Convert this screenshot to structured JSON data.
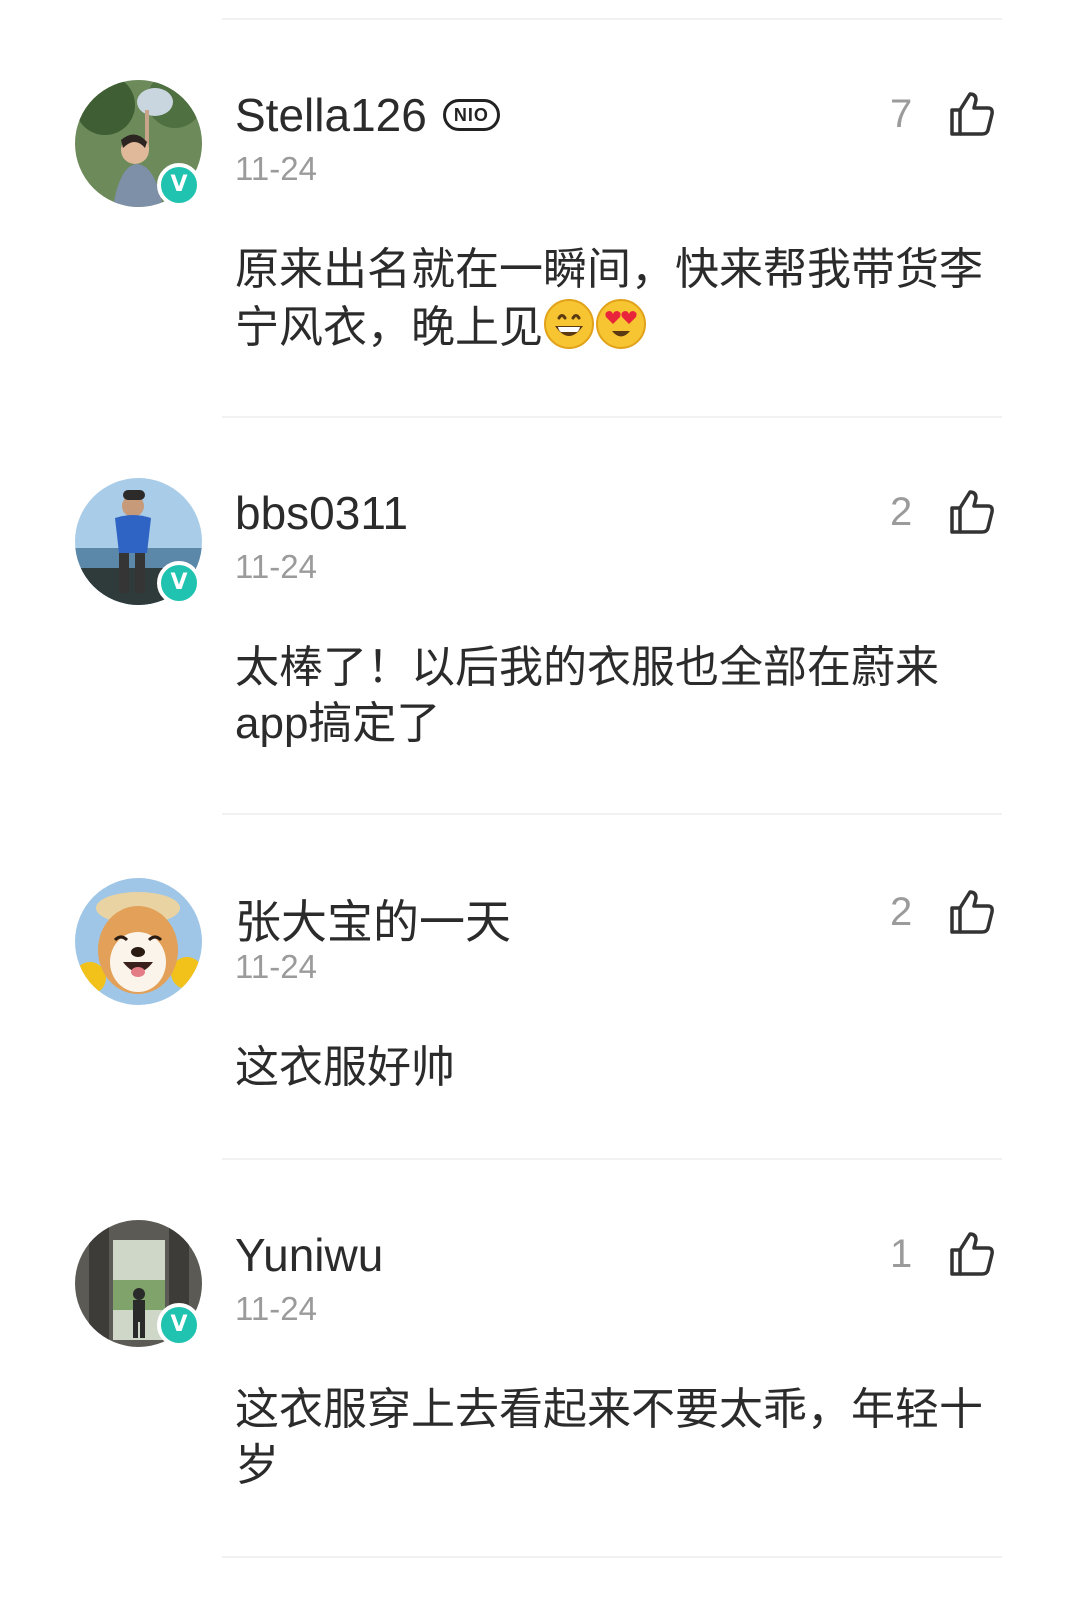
{
  "comments": [
    {
      "username": "Stella126",
      "badge": "NIO",
      "date": "11-24",
      "likes": "7",
      "text": "原来出名就在一瞬间，快来帮我带货李宁风衣，晚上见",
      "verified": "V"
    },
    {
      "username": "bbs0311",
      "date": "11-24",
      "likes": "2",
      "text": "太棒了！以后我的衣服也全部在蔚来app搞定了",
      "verified": "V"
    },
    {
      "username": "张大宝的一天",
      "date": "11-24",
      "likes": "2",
      "text": "这衣服好帅"
    },
    {
      "username": "Yuniwu",
      "date": "11-24",
      "likes": "1",
      "text": "这衣服穿上去看起来不要太乖，年轻十岁",
      "verified": "V"
    }
  ],
  "colors": {
    "verified_badge": "#1fc3b0",
    "muted_text": "#9b9b9b",
    "primary_text": "#2b2b2b",
    "divider": "#f1f1f1"
  },
  "icons": {
    "like": "thumbs-up-icon",
    "verified": "verified-v-icon",
    "emoji_1": "grinning-face-emoji",
    "emoji_2": "heart-eyes-emoji"
  }
}
